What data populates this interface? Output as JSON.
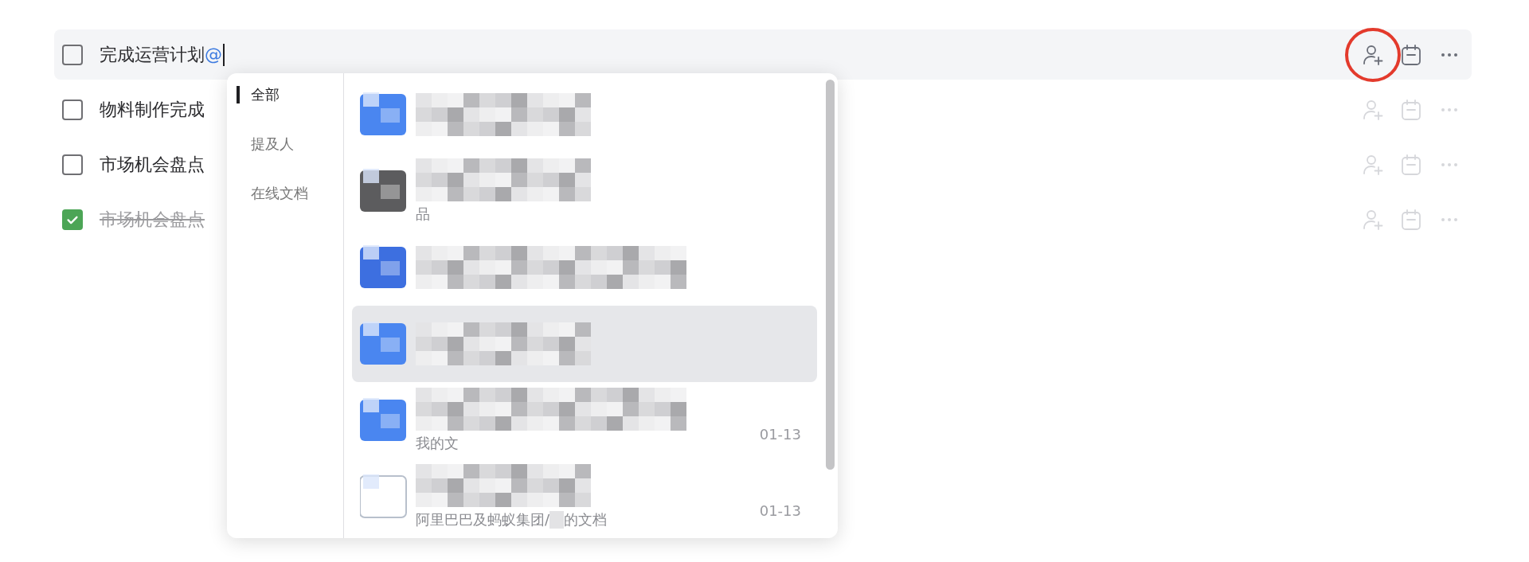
{
  "tasks": [
    {
      "text": "完成运营计划",
      "mention": "@",
      "checked": false,
      "hovered": true,
      "annotated": true
    },
    {
      "text": "物料制作完成",
      "checked": false,
      "hovered": false,
      "annotated": false
    },
    {
      "text": "市场机会盘点",
      "checked": false,
      "hovered": false,
      "annotated": false
    },
    {
      "text": "市场机会盘点",
      "checked": true,
      "hovered": false,
      "annotated": false
    }
  ],
  "mention_popup": {
    "tabs": [
      {
        "label": "全部",
        "selected": true
      },
      {
        "label": "提及人",
        "selected": false
      },
      {
        "label": "在线文档",
        "selected": false
      }
    ],
    "items": [
      {
        "kind": "folder",
        "selected": false
      },
      {
        "kind": "photo",
        "subtitle": [
          "品"
        ],
        "selected": false
      },
      {
        "kind": "logo",
        "selected": false
      },
      {
        "kind": "folder",
        "selected": true
      },
      {
        "kind": "folder",
        "subtitle": [
          "我的文"
        ],
        "date": "01-13",
        "selected": false
      },
      {
        "kind": "doc",
        "subtitle": [
          "阿里巴巴及蚂蚁集团/",
          "的文档"
        ],
        "date": "01-13",
        "selected": false
      }
    ]
  }
}
